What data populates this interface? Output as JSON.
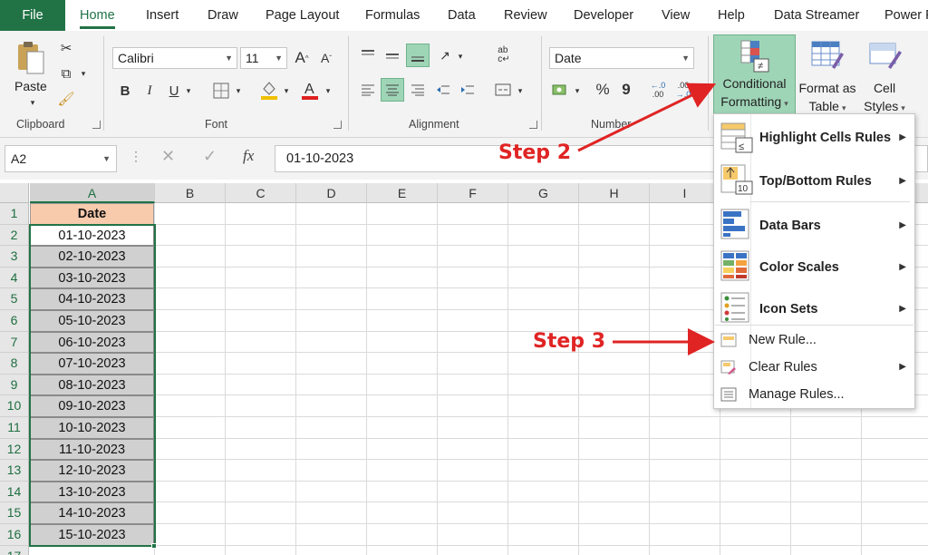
{
  "tabs": [
    "File",
    "Home",
    "Insert",
    "Draw",
    "Page Layout",
    "Formulas",
    "Data",
    "Review",
    "Developer",
    "View",
    "Help",
    "Data Streamer",
    "Power P"
  ],
  "clipboard": {
    "paste_label": "Paste",
    "group_label": "Clipboard"
  },
  "font": {
    "name": "Calibri",
    "size": "11",
    "group_label": "Font"
  },
  "alignment": {
    "group_label": "Alignment"
  },
  "number": {
    "format": "Date",
    "group_label": "Number",
    "percent": "%",
    "comma": "9",
    "inc_decimal": ".00",
    "dec_decimal": ".00"
  },
  "styles": {
    "conditional_formatting": [
      "Conditional",
      "Formatting"
    ],
    "format_as_table": [
      "Format as",
      "Table"
    ],
    "cell_styles": [
      "Cell",
      "Styles"
    ]
  },
  "formula_bar": {
    "name_box": "A2",
    "fx": "fx",
    "value": "01-10-2023"
  },
  "columns": [
    "A",
    "B",
    "C",
    "D",
    "E",
    "F",
    "G",
    "H",
    "I"
  ],
  "rows": [
    "1",
    "2",
    "3",
    "4",
    "5",
    "6",
    "7",
    "8",
    "9",
    "10",
    "11",
    "12",
    "13",
    "14",
    "15",
    "16",
    "17"
  ],
  "cells": {
    "header": "Date",
    "dates": [
      "01-10-2023",
      "02-10-2023",
      "03-10-2023",
      "04-10-2023",
      "05-10-2023",
      "06-10-2023",
      "07-10-2023",
      "08-10-2023",
      "09-10-2023",
      "10-10-2023",
      "11-10-2023",
      "12-10-2023",
      "13-10-2023",
      "14-10-2023",
      "15-10-2023"
    ]
  },
  "menu": {
    "highlight_cells_rules": "Highlight Cells Rules",
    "top_bottom_rules": "Top/Bottom Rules",
    "data_bars": "Data Bars",
    "color_scales": "Color Scales",
    "icon_sets": "Icon Sets",
    "new_rule": "New Rule...",
    "clear_rules": "Clear Rules",
    "manage_rules": "Manage Rules..."
  },
  "annotations": {
    "step2": "Step 2",
    "step3": "Step 3"
  },
  "colors": {
    "excel_green": "#217346",
    "header_fill": "#f8cbad",
    "selection_fill": "#d0d0d0",
    "annotation_red": "#e02424",
    "highlight_button": "#9fd5b7"
  }
}
